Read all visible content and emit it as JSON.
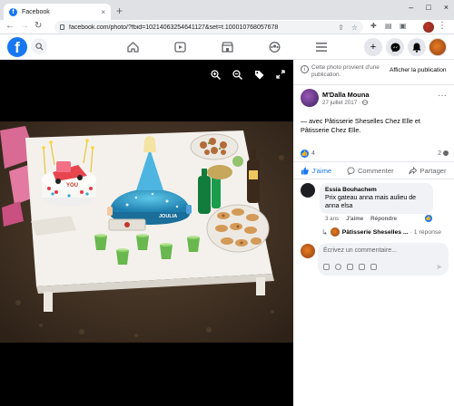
{
  "browser": {
    "tab_title": "Facebook",
    "tab_favicon": "f",
    "tab_close": "×",
    "new_tab": "+",
    "url": "facebook.com/photo/?fbid=102140632546411​27&set=t.100010768057678",
    "win_minimize": "–",
    "win_maximize": "□",
    "win_close": "×"
  },
  "facebook_nav": {
    "logo": "f",
    "create": "+"
  },
  "panel": {
    "notice_text": "Cette photo provient d'une publication.",
    "notice_button": "Afficher la publication",
    "post": {
      "author": "M'Dalla Mouna",
      "date": "27 juillet 2017 · ",
      "caption": "— avec Pâtisserie Sheselles Chez Elle et Pâtisserie Chez Elle.",
      "reactions": "4",
      "comments": "2"
    },
    "actions": {
      "like": "J'aime",
      "comment": "Commenter",
      "share": "Partager"
    },
    "comment": {
      "author": "Essia Bouhachem",
      "text": "Prix gateau anna mais aulieu de anna elsa",
      "time": "3 ans",
      "like": "J'aime",
      "reply": "Répondre"
    },
    "reply": {
      "name": "Pâtisserie Sheselles ...",
      "suffix": "· 1 réponse"
    },
    "input_placeholder": "Écrivez un commentaire..."
  },
  "photo": {
    "cake_label": "YOU",
    "cake_label_2": "JOULIA"
  },
  "colors": {
    "brand": "#1877f2",
    "tablecloth": "#f4f1ec",
    "carpet": "#4a3a2a"
  }
}
